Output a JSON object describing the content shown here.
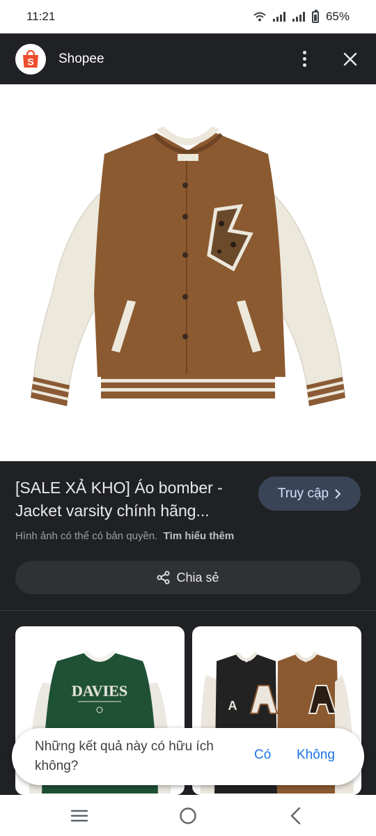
{
  "status": {
    "time": "11:21",
    "battery": "65%",
    "icons": [
      "wifi-icon",
      "signal-icon",
      "signal-icon",
      "battery-icon"
    ]
  },
  "header": {
    "title": "Shopee",
    "logo_letter": "S",
    "brand_color": "#ee4d2d"
  },
  "product": {
    "title": "[SALE XẢ KHO] Áo bomber - Jacket varsity chính hãng...",
    "visit_label": "Truy cập",
    "copyright": "Hình ảnh có thể có bản quyền.",
    "learn_more": "Tìm hiểu thêm",
    "share_label": "Chia sẻ"
  },
  "related": [
    {
      "brand_text": "DAVIES"
    },
    {
      "brand_text": "A"
    }
  ],
  "feedback": {
    "question": "Những kết quả này có hữu ích không?",
    "yes": "Có",
    "no": "Không"
  },
  "colors": {
    "accent": "#1a73e8",
    "visit_bg": "#394457",
    "page_bg": "#202124"
  }
}
